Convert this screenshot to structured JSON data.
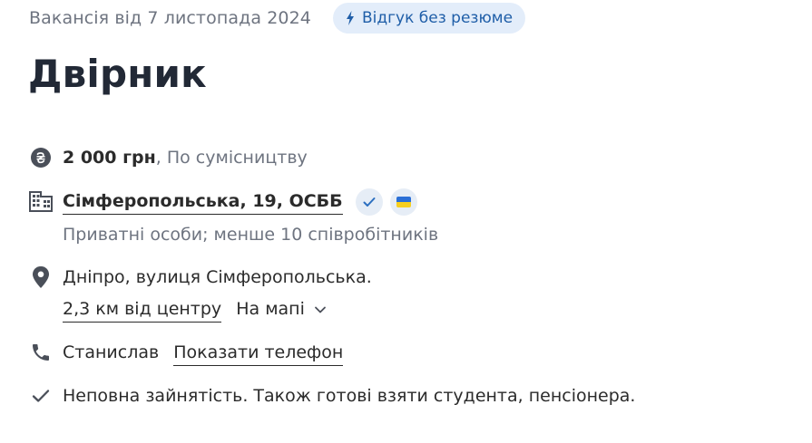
{
  "header": {
    "posted": "Вакансія від 7 листопада 2024",
    "badge": "Відгук без резюме",
    "title": "Двірник"
  },
  "salary": {
    "amount": "2 000 грн",
    "employment": ", По сумісництву"
  },
  "company": {
    "name": "Сімферопольська, 19, ОСББ",
    "description": "Приватні особи; менше 10 співробітників"
  },
  "location": {
    "address": "Дніпро, вулиця Сімферопольська.",
    "distance": "2,3 км від центру",
    "map_label": "На мапі"
  },
  "contact": {
    "name": "Станислав",
    "phone_link": "Показати телефон"
  },
  "conditions": {
    "text": "Неповна зайнятість. Також готові взяти студента, пенсіонера."
  },
  "colors": {
    "badge_bg": "#e3edfa",
    "badge_text": "#1f5ea8",
    "muted": "#6e7480"
  }
}
